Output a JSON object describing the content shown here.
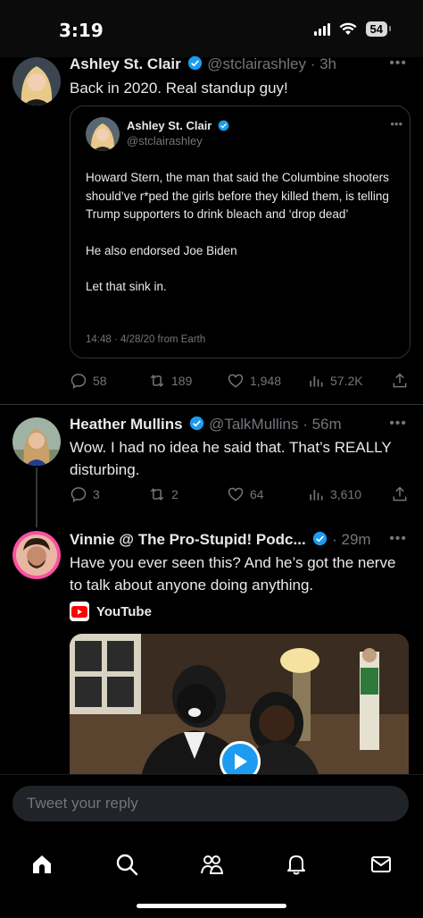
{
  "status_bar": {
    "time": "3:19",
    "battery": "54"
  },
  "tweets": [
    {
      "name": "Ashley St. Clair",
      "handle": "@stclairashley",
      "time": "· 3h",
      "text": "Back in 2020. Real standup guy!",
      "quote": {
        "name": "Ashley St. Clair",
        "handle": "@stclairashley",
        "paragraphs": [
          "Howard Stern, the man that said the Columbine shooters should’ve r*ped the girls before they killed them, is telling Trump supporters to drink bleach and ‘drop dead’",
          "He also endorsed Joe Biden",
          "Let that sink in."
        ],
        "timestamp": "14:48 · 4/28/20 from Earth"
      },
      "stats": {
        "replies": "58",
        "retweets": "189",
        "likes": "1,948",
        "views": "57.2K"
      }
    },
    {
      "name": "Heather Mullins",
      "handle": "@TalkMullins",
      "time": "· 56m",
      "text": "Wow. I had no idea he said that. That’s REALLY disturbing.",
      "stats": {
        "replies": "3",
        "retweets": "2",
        "likes": "64",
        "views": "3,610"
      }
    },
    {
      "name": "Vinnie @ The Pro-Stupid! Podc...",
      "handle": "",
      "time": "· 29m",
      "text": "Have you ever seen this? And he’s got the nerve to talk about anyone doing anything.",
      "link_source": "YouTube"
    }
  ],
  "reply": {
    "placeholder": "Tweet your reply"
  },
  "colors": {
    "accent": "#1d9bf0",
    "muted": "#71767b",
    "youtube": "#ff0000"
  }
}
